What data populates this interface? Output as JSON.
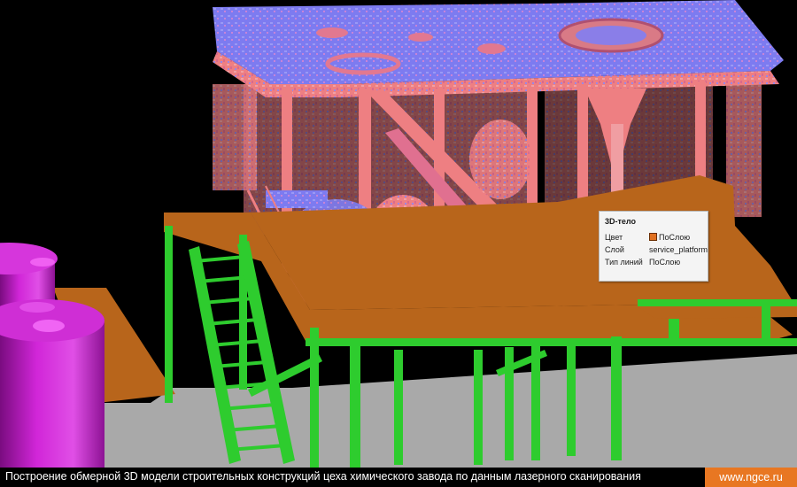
{
  "viewport": {
    "background_color": "#000000",
    "ground_color": "#a9a9a9",
    "platform_color": "#b8651b",
    "steel_color": "#2ecc2e",
    "tank_color": "#c21fc8",
    "pointcloud_primary": "#ee7f82",
    "pointcloud_secondary": "#7a78ee"
  },
  "properties_tooltip": {
    "title": "3D-тело",
    "rows": [
      {
        "key": "Цвет",
        "value": "ПоСлою",
        "swatch": "#e07020"
      },
      {
        "key": "Слой",
        "value": "service_platform"
      },
      {
        "key": "Тип линий",
        "value": "ПоСлою"
      }
    ]
  },
  "caption": {
    "text": "Построение обмерной 3D модели строительных конструкций цеха химического завода по данным лазерного сканирования",
    "site": "www.ngce.ru",
    "site_bg": "#e87722"
  }
}
